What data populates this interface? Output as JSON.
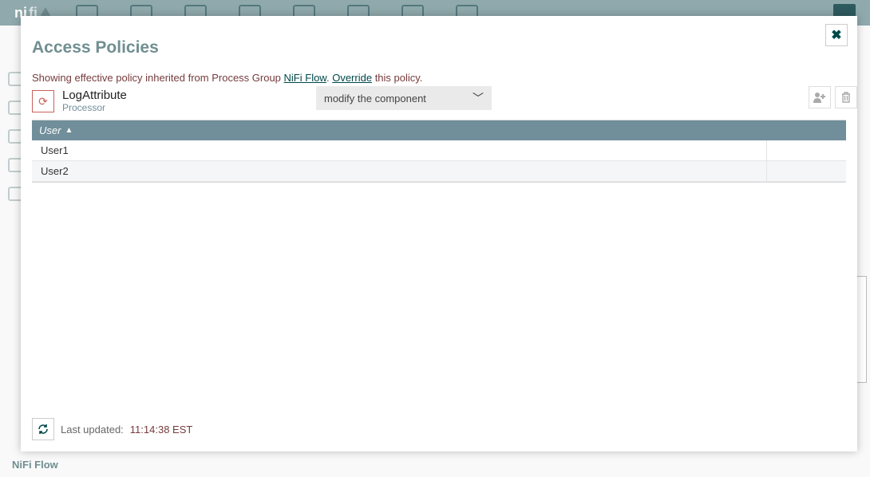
{
  "bg": {
    "breadcrumb": "NiFi Flow"
  },
  "dialog": {
    "title": "Access Policies",
    "close_glyph": "✖",
    "policy_message": {
      "prefix": "Showing effective policy inherited from Process Group ",
      "link1": "NiFi Flow",
      "middle": ". ",
      "link2": "Override",
      "suffix": " this policy."
    },
    "component": {
      "icon_glyph": "⟳",
      "name": "LogAttribute",
      "type": "Processor"
    },
    "policy_select": {
      "value": "modify the component",
      "chevron": "﹀"
    },
    "actions": {
      "add_user_glyph": "👤",
      "delete_glyph": "🗑"
    },
    "table": {
      "header": "User",
      "sort_glyph": "▲",
      "rows": [
        {
          "user": "User1"
        },
        {
          "user": "User2"
        }
      ]
    },
    "footer": {
      "refresh_glyph": "⟲",
      "label": "Last updated:",
      "time": "11:14:38 EST"
    }
  }
}
